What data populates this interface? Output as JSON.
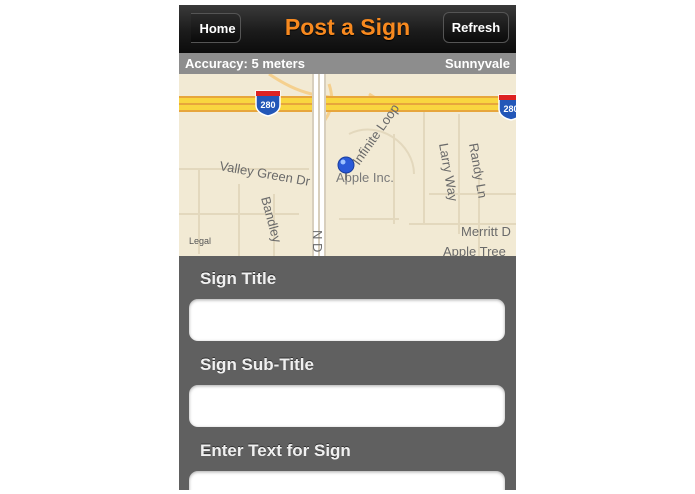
{
  "nav": {
    "title": "Post a Sign",
    "home_label": "Home",
    "refresh_label": "Refresh"
  },
  "status": {
    "accuracy": "Accuracy: 5 meters",
    "city": "Sunnyvale"
  },
  "map": {
    "legal": "Legal",
    "highway_shield": "280",
    "streets": [
      "Valley Green Dr",
      "Infinite Loop",
      "Larry Way",
      "Randy Ln",
      "Bandley",
      "N D",
      "Merritt D",
      "Apple Tree"
    ],
    "place": "Apple Inc."
  },
  "form": {
    "fields": [
      {
        "label": "Sign Title",
        "value": ""
      },
      {
        "label": "Sign Sub-Title",
        "value": ""
      },
      {
        "label": "Enter Text for Sign",
        "value": ""
      }
    ]
  },
  "colors": {
    "accent": "#f7891f",
    "pin": "#2a5ad8",
    "highway": "#f7cb3c"
  }
}
